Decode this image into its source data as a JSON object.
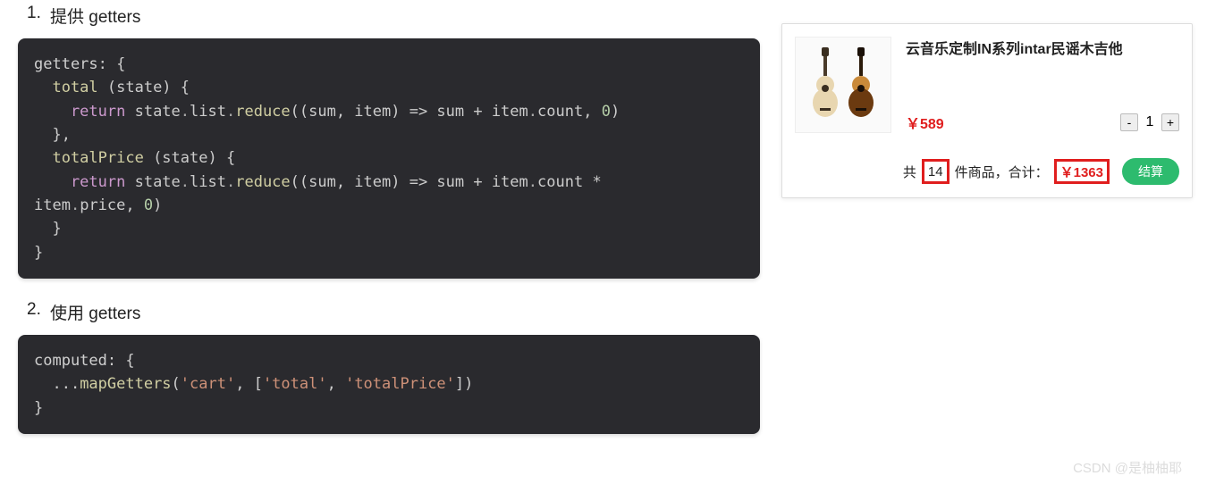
{
  "headings": {
    "h1_num": "1.",
    "h1_text": "提供 getters",
    "h2_num": "2.",
    "h2_text": "使用 getters"
  },
  "code1": {
    "l1_a": "getters",
    "l1_b": ": {",
    "l2_a": "  total ",
    "l2_b": "(state) {",
    "l3_a": "    return",
    "l3_b": " state",
    "l3_c": ".",
    "l3_d": "list",
    "l3_e": ".",
    "l3_f": "reduce",
    "l3_g": "((sum, item) => sum + item",
    "l3_h": ".",
    "l3_i": "count",
    "l3_j": ", ",
    "l3_k": "0",
    "l3_l": ")",
    "l4": "  },",
    "l5_a": "  totalPrice ",
    "l5_b": "(state) {",
    "l6_a": "    return",
    "l6_b": " state",
    "l6_c": ".",
    "l6_d": "list",
    "l6_e": ".",
    "l6_f": "reduce",
    "l6_g": "((sum, item) => sum + item",
    "l6_h": ".",
    "l6_i": "count",
    "l6_j": " * ",
    "l7_a": "item",
    "l7_b": ".",
    "l7_c": "price",
    "l7_d": ", ",
    "l7_e": "0",
    "l7_f": ")",
    "l8": "  }",
    "l9": "}"
  },
  "code2": {
    "l1_a": "computed",
    "l1_b": ": {",
    "l2_a": "  ...",
    "l2_b": "mapGetters",
    "l2_c": "(",
    "l2_d": "'cart'",
    "l2_e": ", [",
    "l2_f": "'total'",
    "l2_g": ", ",
    "l2_h": "'totalPrice'",
    "l2_i": "])",
    "l3": "}"
  },
  "product": {
    "title": "云音乐定制IN系列intar民谣木吉他",
    "price": "￥589",
    "qty": "1",
    "minus": "-",
    "plus": "+"
  },
  "summary": {
    "a": "共",
    "count": "14",
    "b": "件商品，合计：",
    "total": "￥1363",
    "checkout": "结算"
  },
  "watermark": "CSDN @是柚柚耶"
}
